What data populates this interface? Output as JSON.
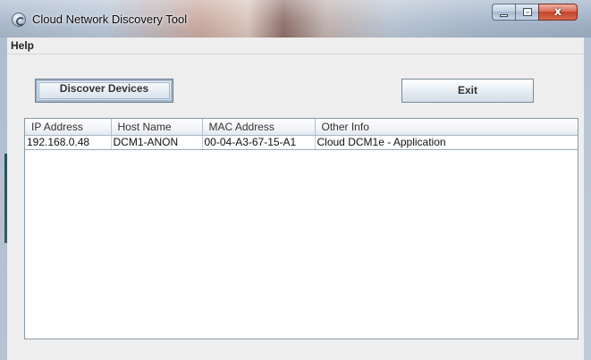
{
  "window": {
    "title": "Cloud Network Discovery Tool",
    "icon": "app-logo-icon",
    "controls": {
      "minimize_icon": "minimize-icon",
      "maximize_icon": "maximize-icon",
      "close_icon": "close-icon",
      "close_glyph": "x"
    }
  },
  "menubar": {
    "items": [
      {
        "label": "Help"
      }
    ]
  },
  "toolbar": {
    "discover_label": "Discover Devices",
    "exit_label": "Exit"
  },
  "table": {
    "columns": [
      "IP Address",
      "Host Name",
      "MAC Address",
      "Other Info"
    ],
    "rows": [
      {
        "ip": "192.168.0.48",
        "host": "DCM1-ANON",
        "mac": "00-04-A3-67-15-A1",
        "info": "Cloud DCM1e - Application"
      }
    ]
  },
  "colors": {
    "close_button": "#c4432a",
    "window_background": "#eeeeee",
    "table_background": "#ffffff"
  }
}
